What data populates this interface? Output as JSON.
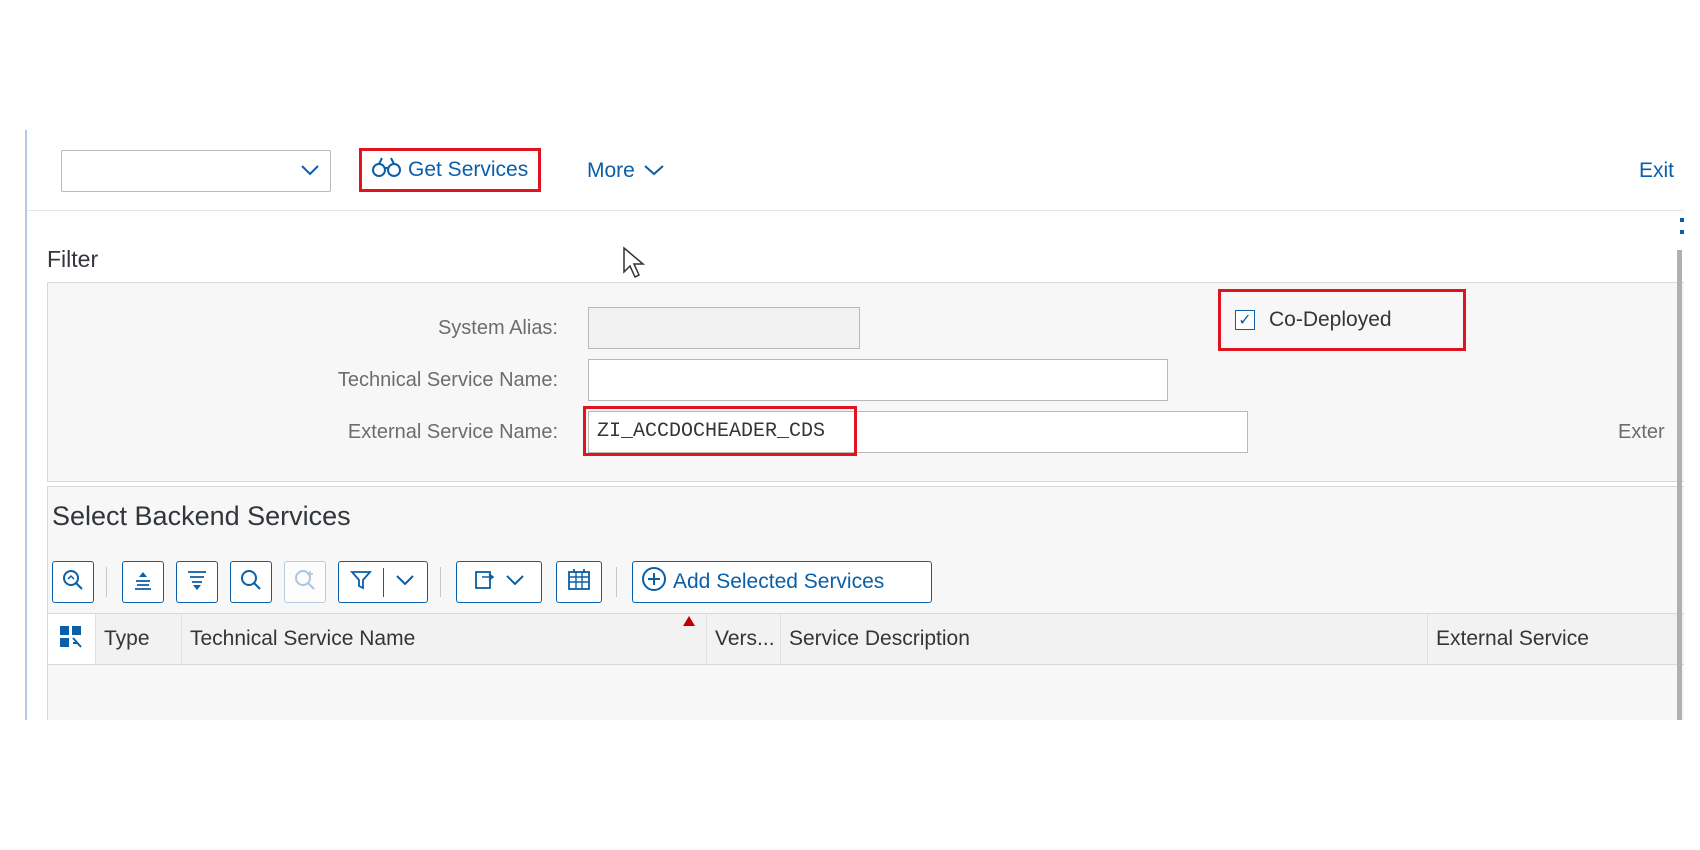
{
  "toolbar": {
    "dropdown_value": "",
    "get_services_label": "Get Services",
    "more_label": "More",
    "exit_label": "Exit"
  },
  "filter": {
    "title": "Filter",
    "system_alias_label": "System Alias:",
    "system_alias_value": "",
    "technical_service_name_label": "Technical Service Name:",
    "technical_service_name_value": "",
    "external_service_name_label": "External Service Name:",
    "external_service_name_value": "ZI_ACCDOCHEADER_CDS",
    "codeployed_label": "Co-Deployed",
    "codeployed_checked": true,
    "truncated_label": "Exter"
  },
  "backend_services": {
    "title": "Select Backend Services",
    "add_selected_label": "Add Selected Services",
    "columns": [
      "Type",
      "Technical Service Name",
      "Vers...",
      "Service Description",
      "External Service"
    ]
  },
  "colors": {
    "accent": "#0a5fa8",
    "highlight": "#e0141e",
    "panel_bg": "#f7f7f7"
  }
}
